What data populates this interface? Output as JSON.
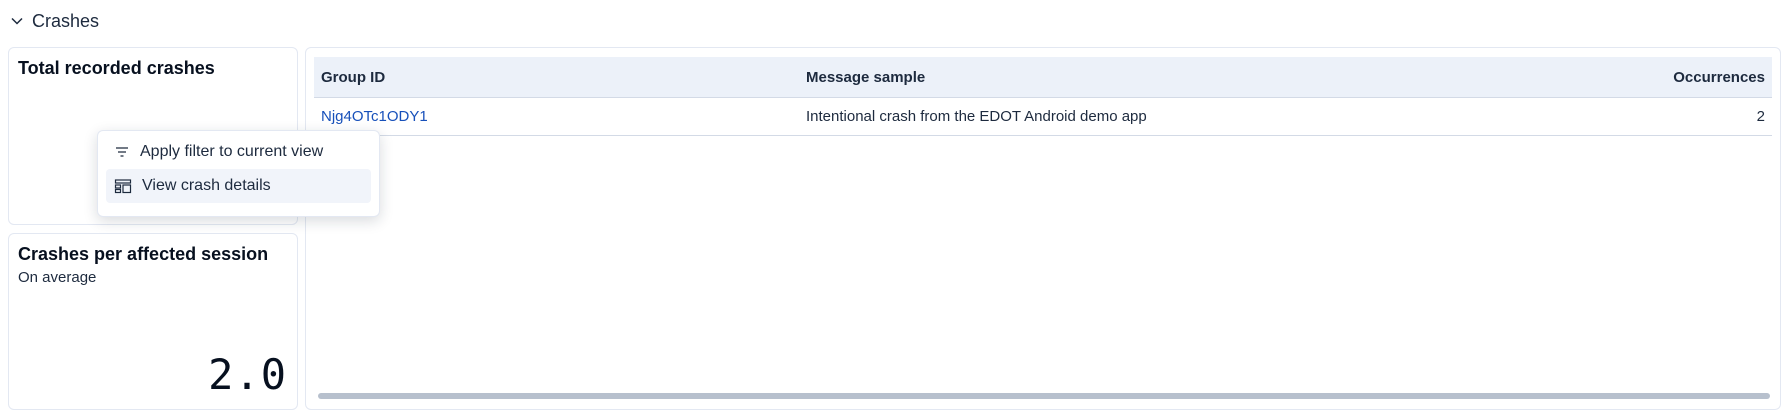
{
  "section": {
    "title": "Crashes",
    "icon": "chevron-down-icon"
  },
  "total_panel": {
    "title": "Total recorded crashes"
  },
  "avg_panel": {
    "title": "Crashes per affected session",
    "subtitle": "On average",
    "value": "2.0"
  },
  "table": {
    "columns": [
      "Group ID",
      "Message sample",
      "Occurrences"
    ],
    "rows": [
      {
        "group_id": "Njg4OTc1ODY1",
        "message": "Intentional crash from the EDOT Android demo app",
        "occurrences": "2"
      }
    ]
  },
  "popover": {
    "items": [
      {
        "label": "Apply filter to current view",
        "icon": "filter-icon"
      },
      {
        "label": "View crash details",
        "icon": "table-details-icon"
      }
    ]
  },
  "colors": {
    "link": "#1750ba",
    "header_bg": "#ecf1f9",
    "border": "#e3e8f2"
  }
}
